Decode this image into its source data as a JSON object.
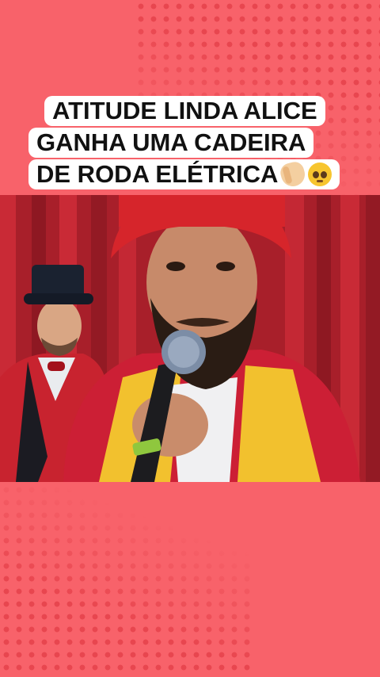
{
  "caption": {
    "line1": "ATITUDE LINDA ALICE",
    "line2": "GANHA UMA CADEIRA",
    "line3": "DE RODA ELÉTRICA",
    "emoji1": "clapping-hands",
    "emoji2": "pleading-face"
  },
  "colors": {
    "background": "#f8626a",
    "dots": "#e8464f",
    "curtain": "#b3222d",
    "hat": "#d6252b"
  }
}
